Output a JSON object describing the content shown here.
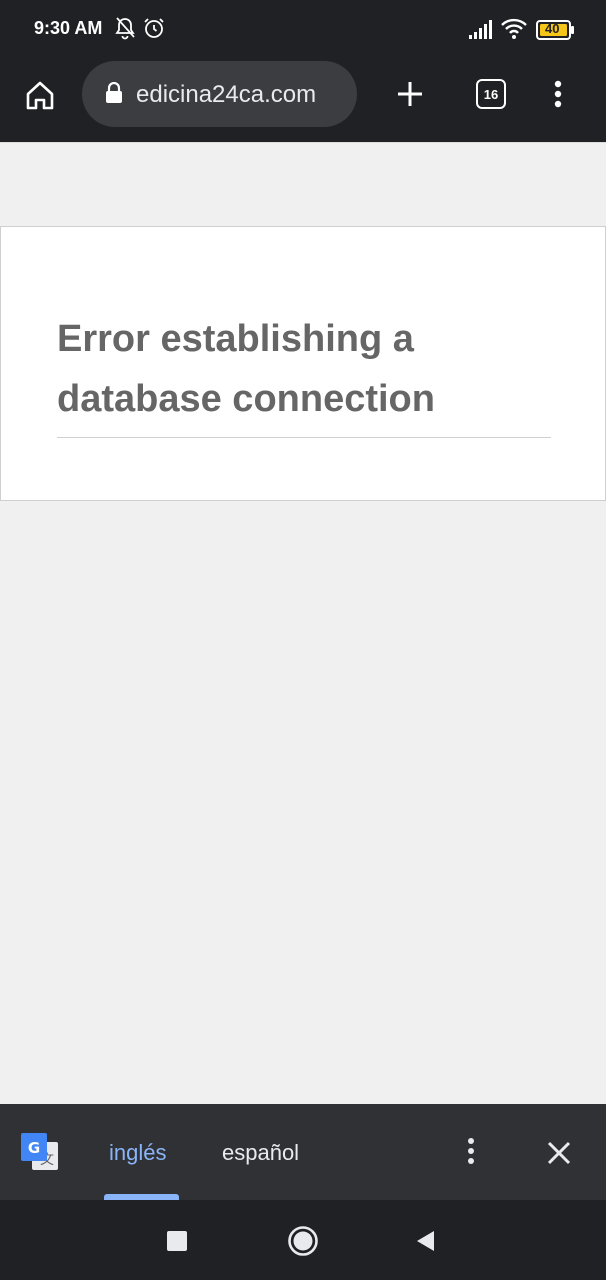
{
  "status_bar": {
    "time": "9:30 AM",
    "icons": [
      "bell-off-icon",
      "alarm-icon",
      "signal-icon",
      "wifi-icon",
      "battery-icon"
    ],
    "battery_level": "40"
  },
  "toolbar": {
    "url": "edicina24ca.com",
    "tab_count": "16",
    "icons": [
      "home-icon",
      "lock-icon",
      "new-tab-icon",
      "menu-icon"
    ]
  },
  "page": {
    "error_title": "Error establishing a database connection"
  },
  "translate_bar": {
    "source_language": "inglés",
    "target_language": "español",
    "icons": [
      "google-translate-icon",
      "more-options-icon",
      "close-icon"
    ]
  },
  "nav_bar": {
    "icons": [
      "recents-icon",
      "home-circle-icon",
      "back-icon"
    ]
  },
  "colors": {
    "chrome_dark": "#202124",
    "url_pill": "#3c3d40",
    "page_bg": "#f0f0f0",
    "error_text": "#666666",
    "accent_blue": "#8ab4f8",
    "battery_yellow": "#f5c518"
  }
}
